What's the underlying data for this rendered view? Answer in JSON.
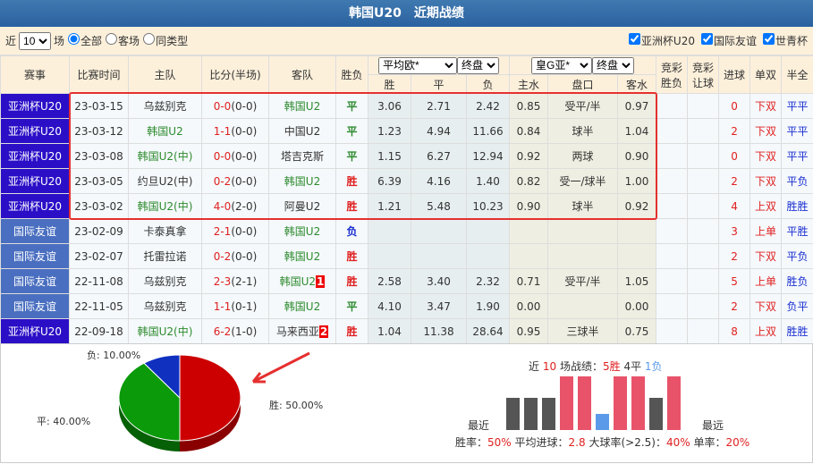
{
  "title": "韩国U20　近期战绩",
  "filter": {
    "prefix": "近",
    "count": "10",
    "suffix": "场",
    "radios": [
      "全部",
      "客场",
      "同类型"
    ],
    "checks": [
      "亚洲杯U20",
      "国际友谊",
      "世青杯"
    ]
  },
  "headers": {
    "league": "赛事",
    "time": "比赛时间",
    "home": "主队",
    "score": "比分(半场)",
    "away": "客队",
    "result": "胜负",
    "eu_select": "平均欧*",
    "eu_close": "终盘",
    "asia_select": "皇G亚*",
    "asia_close": "终盘",
    "jc1": "竞彩胜负",
    "jc2": "竞彩让球",
    "goals": "进球",
    "oe": "单双",
    "hf": "半全",
    "win": "胜",
    "draw": "平",
    "lose": "负",
    "hw": "主水",
    "line": "盘口",
    "aw": "客水"
  },
  "colors": {
    "asia_cup": "#2a0fc7",
    "friendly": "#4a6fc0",
    "win_bar": "#e8536a",
    "draw_bar": "#555555",
    "lose_bar": "#5b9ae8"
  },
  "rows": [
    {
      "league": "亚洲杯U20",
      "type": "cup",
      "time": "23-03-15",
      "home": "乌兹别克",
      "hc": "",
      "ft": "0-0",
      "ht": "(0-0)",
      "away": "韩国U2",
      "ac": "green",
      "res": "平",
      "rc": "green",
      "w": "3.06",
      "d": "2.71",
      "l": "2.42",
      "hw": "0.85",
      "line": "受平/半",
      "aw": "0.97",
      "goals": "0",
      "oe": "下双",
      "hf": "平平"
    },
    {
      "league": "亚洲杯U20",
      "type": "cup",
      "time": "23-03-12",
      "home": "韩国U2",
      "hc": "green",
      "ft": "1-1",
      "ht": "(0-0)",
      "away": "中国U2",
      "ac": "",
      "res": "平",
      "rc": "green",
      "w": "1.23",
      "d": "4.94",
      "l": "11.66",
      "hw": "0.84",
      "line": "球半",
      "aw": "1.04",
      "goals": "2",
      "oe": "下双",
      "hf": "平平"
    },
    {
      "league": "亚洲杯U20",
      "type": "cup",
      "time": "23-03-08",
      "home": "韩国U2(中)",
      "hc": "green",
      "ft": "0-0",
      "ht": "(0-0)",
      "away": "塔吉克斯",
      "ac": "",
      "res": "平",
      "rc": "green",
      "w": "1.15",
      "d": "6.27",
      "l": "12.94",
      "hw": "0.92",
      "line": "两球",
      "aw": "0.90",
      "goals": "0",
      "oe": "下双",
      "hf": "平平"
    },
    {
      "league": "亚洲杯U20",
      "type": "cup",
      "time": "23-03-05",
      "home": "约旦U2(中)",
      "hc": "",
      "ft": "0-2",
      "ht": "(0-0)",
      "away": "韩国U2",
      "ac": "green",
      "res": "胜",
      "rc": "red",
      "w": "6.39",
      "d": "4.16",
      "l": "1.40",
      "hw": "0.82",
      "line": "受一/球半",
      "aw": "1.00",
      "goals": "2",
      "oe": "下双",
      "hf": "平负"
    },
    {
      "league": "亚洲杯U20",
      "type": "cup",
      "time": "23-03-02",
      "home": "韩国U2(中)",
      "hc": "green",
      "ft": "4-0",
      "ht": "(2-0)",
      "away": "阿曼U2",
      "ac": "",
      "res": "胜",
      "rc": "red",
      "w": "1.21",
      "d": "5.48",
      "l": "10.23",
      "hw": "0.90",
      "line": "球半",
      "aw": "0.92",
      "goals": "4",
      "oe": "上双",
      "hf": "胜胜"
    },
    {
      "league": "国际友谊",
      "type": "fr",
      "time": "23-02-09",
      "home": "卡泰真拿",
      "hc": "",
      "ft": "2-1",
      "ht": "(0-0)",
      "away": "韩国U2",
      "ac": "green",
      "res": "负",
      "rc": "blue",
      "w": "",
      "d": "",
      "l": "",
      "hw": "",
      "line": "",
      "aw": "",
      "goals": "3",
      "oe": "上单",
      "hf": "平胜"
    },
    {
      "league": "国际友谊",
      "type": "fr",
      "time": "23-02-07",
      "home": "托雷拉诺",
      "hc": "",
      "ft": "0-2",
      "ht": "(0-0)",
      "away": "韩国U2",
      "ac": "green",
      "res": "胜",
      "rc": "red",
      "w": "",
      "d": "",
      "l": "",
      "hw": "",
      "line": "",
      "aw": "",
      "goals": "2",
      "oe": "下双",
      "hf": "平负"
    },
    {
      "league": "国际友谊",
      "type": "fr",
      "time": "22-11-08",
      "home": "乌兹别克",
      "hc": "",
      "ft": "2-3",
      "ht": "(2-1)",
      "away": "韩国U2",
      "ac": "green",
      "card": "1",
      "res": "胜",
      "rc": "red",
      "w": "2.58",
      "d": "3.40",
      "l": "2.32",
      "hw": "0.71",
      "line": "受平/半",
      "aw": "1.05",
      "goals": "5",
      "oe": "上单",
      "hf": "胜负"
    },
    {
      "league": "国际友谊",
      "type": "fr",
      "time": "22-11-05",
      "home": "乌兹别克",
      "hc": "",
      "ft": "1-1",
      "ht": "(0-1)",
      "away": "韩国U2",
      "ac": "green",
      "res": "平",
      "rc": "green",
      "w": "4.10",
      "d": "3.47",
      "l": "1.90",
      "hw": "0.00",
      "line": "",
      "aw": "0.00",
      "goals": "2",
      "oe": "下双",
      "hf": "负平"
    },
    {
      "league": "亚洲杯U20",
      "type": "cup",
      "time": "22-09-18",
      "home": "韩国U2(中)",
      "hc": "green",
      "ft": "6-2",
      "ht": "(1-0)",
      "away": "马来西亚",
      "ac": "",
      "card": "2",
      "res": "胜",
      "rc": "red",
      "w": "1.04",
      "d": "11.38",
      "l": "28.64",
      "hw": "0.95",
      "line": "三球半",
      "aw": "0.75",
      "goals": "8",
      "oe": "上双",
      "hf": "胜胜"
    }
  ],
  "chart_data": {
    "type": "pie",
    "slices": [
      {
        "label": "胜: 50.00%",
        "value": 50,
        "color": "#cc0000"
      },
      {
        "label": "平: 40.00%",
        "value": 40,
        "color": "#0a9a0a"
      },
      {
        "label": "负: 10.00%",
        "value": 10,
        "color": "#1030c0"
      }
    ],
    "bars": {
      "values": [
        "平",
        "平",
        "平",
        "胜",
        "胜",
        "负",
        "胜",
        "胜",
        "平",
        "胜"
      ],
      "left_label": "最近",
      "right_label": "最远"
    }
  },
  "summary": {
    "p1": "近",
    "n": "10",
    "p2": "场战绩：",
    "w": "5胜",
    "d": "4平",
    "l": "1负"
  },
  "rates": {
    "win_label": "胜率：",
    "win": "50%",
    "avg_label": "平均进球：",
    "avg": "2.8",
    "big_label": "大球率(>2.5)：",
    "big": "40%",
    "odd_label": "单率：",
    "odd": "20%"
  }
}
